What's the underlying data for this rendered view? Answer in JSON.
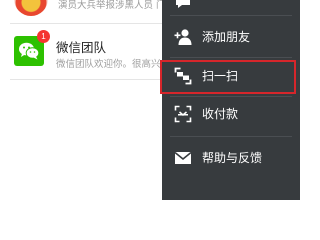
{
  "chats": [
    {
      "preview": "演员大兵举报涉黑人员 门",
      "avatar_icon": "news-avatar-icon"
    },
    {
      "name": "微信团队",
      "preview": "微信团队欢迎你。很高兴",
      "badge": "1",
      "avatar_icon": "wechat-logo-icon"
    }
  ],
  "menu": {
    "items": [
      {
        "label": "",
        "icon": "chat-bubble-icon"
      },
      {
        "label": "添加朋友",
        "icon": "add-friend-icon"
      },
      {
        "label": "扫一扫",
        "icon": "scan-icon",
        "highlighted": true
      },
      {
        "label": "收付款",
        "icon": "payment-icon"
      },
      {
        "label": "帮助与反馈",
        "icon": "mail-icon"
      }
    ]
  },
  "colors": {
    "menu_bg": "#373b3e",
    "highlight_border": "#d6262b",
    "wechat_green": "#2dc100",
    "badge_red": "#f43530"
  }
}
